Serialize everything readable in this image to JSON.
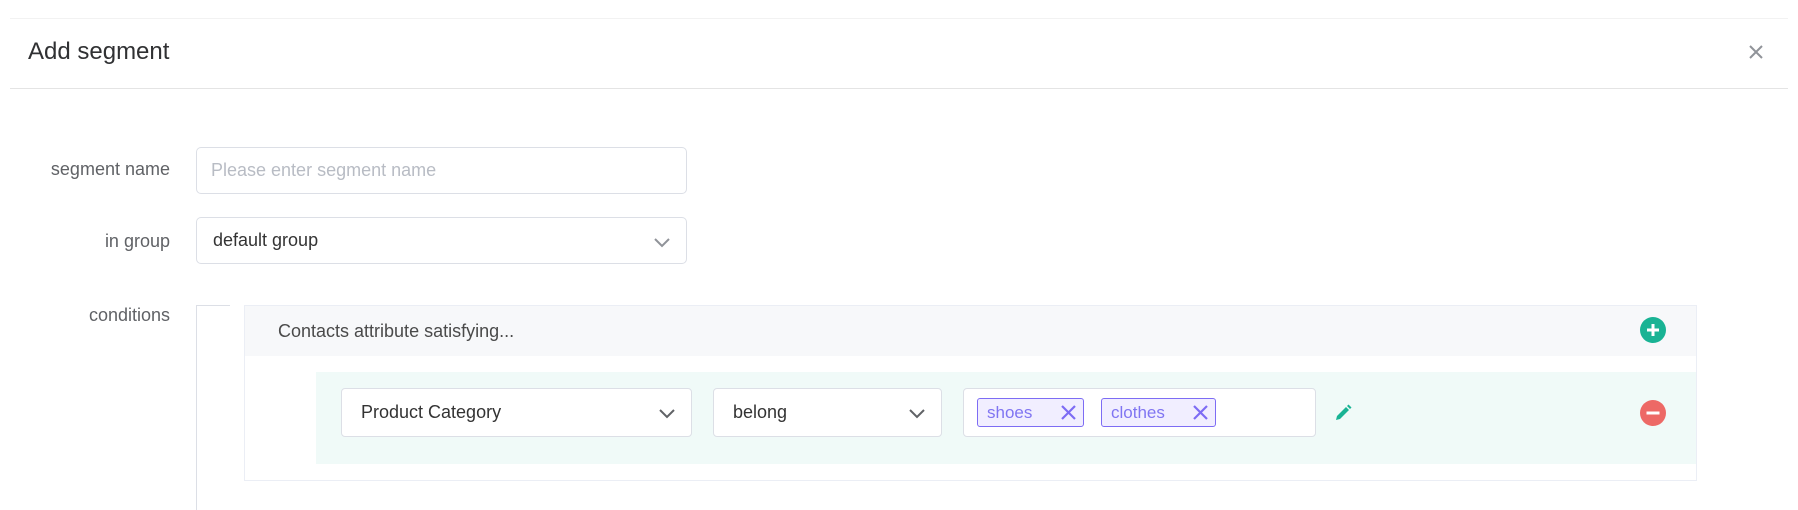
{
  "dialog": {
    "title": "Add segment",
    "close_icon": "close-icon"
  },
  "form": {
    "segment_name": {
      "label": "segment name",
      "value": "",
      "placeholder": "Please enter segment name"
    },
    "group": {
      "label": "in group",
      "value": "default group",
      "icon": "chevron-down-icon"
    },
    "conditions": {
      "label": "conditions",
      "header_text": "Contacts attribute satisfying...",
      "add_icon": "plus-circle-icon",
      "rules": [
        {
          "attribute": "Product Category",
          "operator": "belong",
          "values": [
            "shoes",
            "clothes"
          ],
          "edit_icon": "pencil-icon",
          "remove_icon": "minus-circle-icon"
        }
      ]
    }
  },
  "colors": {
    "accent_green": "#19b394",
    "remove_red": "#ed6966",
    "tag_purple": "#7d6cf4",
    "rule_bg": "#f0faf8"
  }
}
